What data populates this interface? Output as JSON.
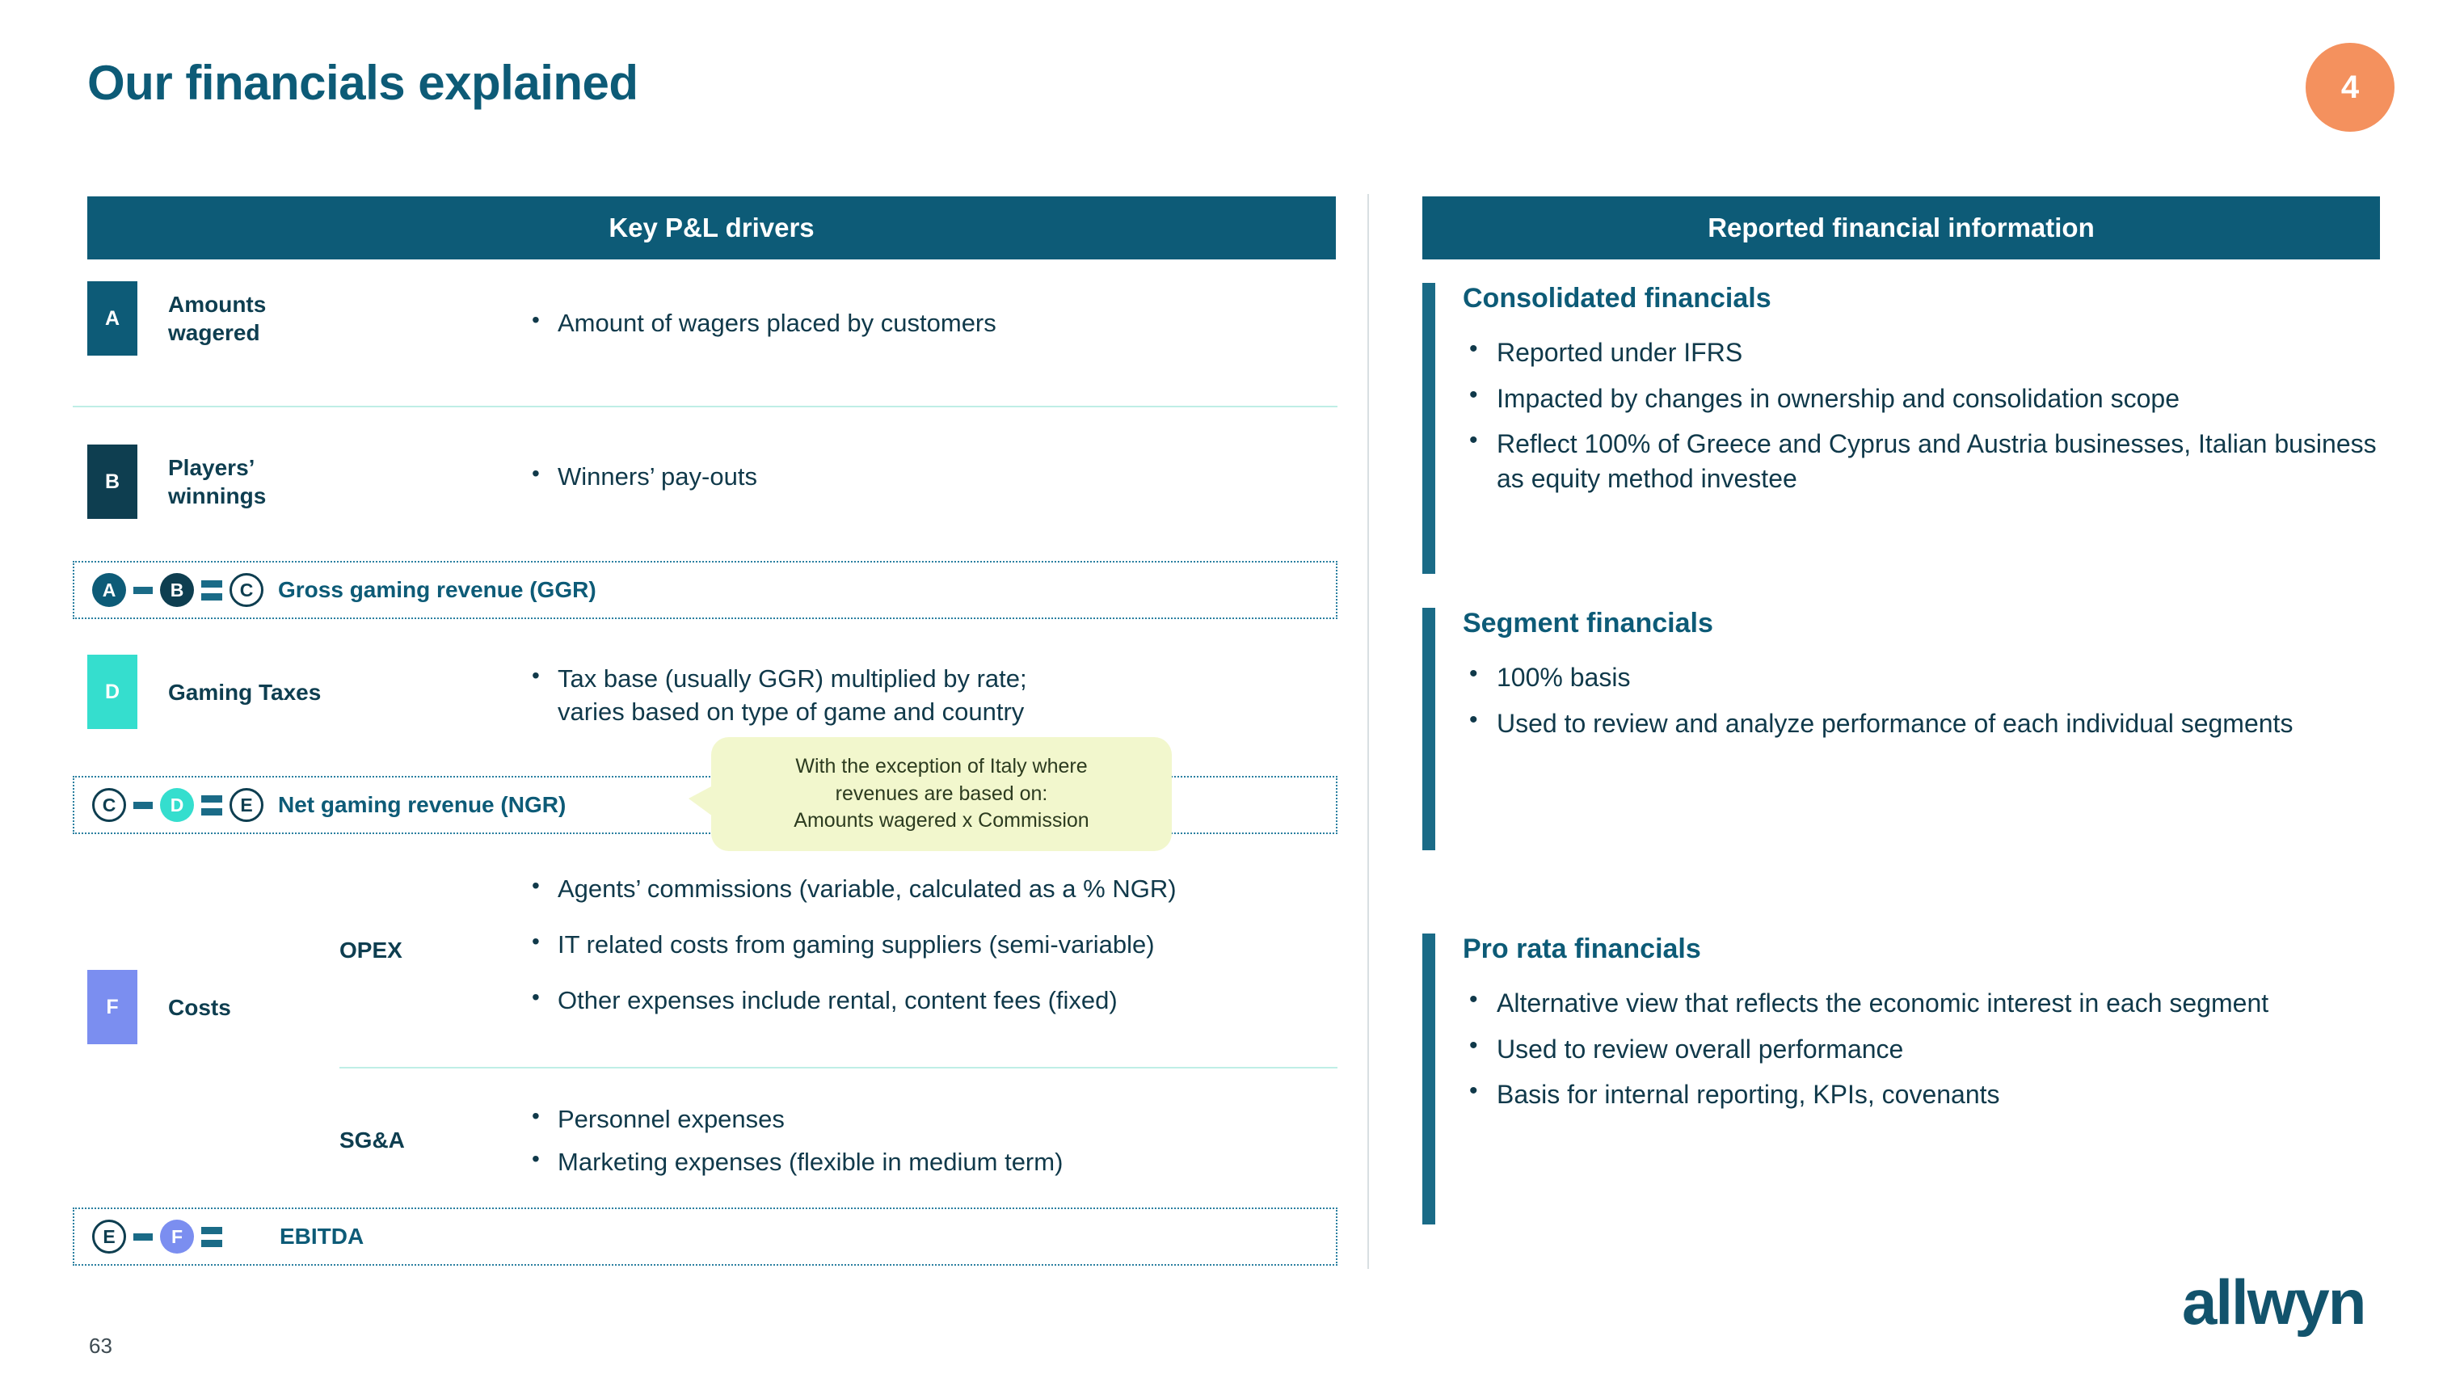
{
  "slide": {
    "title": "Our financials explained",
    "step_number": "4",
    "page_number": "63",
    "logo_text": "allwyn"
  },
  "colors": {
    "brand_teal": "#0d5b77",
    "dark_navy": "#0e3e50",
    "turquoise": "#35dece",
    "periwinkle": "#7b8ef0",
    "orange_badge": "#f4915e",
    "callout_bg": "#f2f7cd",
    "accent_bar": "#1a6b87"
  },
  "left_panel": {
    "header": "Key P&L drivers",
    "drivers": [
      {
        "tag": "A",
        "tag_color": "#0d5b77",
        "label": "Amounts\nwagered",
        "bullets": [
          "Amount of wagers placed by customers"
        ]
      },
      {
        "tag": "B",
        "tag_color": "#0e3e50",
        "label": "Players’\nwinnings",
        "bullets": [
          "Winners’ pay-outs"
        ]
      },
      {
        "tag": "D",
        "tag_color": "#35dece",
        "label": "Gaming Taxes",
        "bullets": [
          "Tax base (usually GGR) multiplied by rate;\nvaries based on type of game and country"
        ]
      },
      {
        "tag": "F",
        "tag_color": "#7b8ef0",
        "label": "Costs",
        "sub_groups": [
          {
            "name": "OPEX",
            "bullets": [
              "Agents’ commissions (variable, calculated as a % NGR)",
              "IT related costs from gaming suppliers (semi-variable)",
              "Other expenses include rental, content fees (fixed)"
            ]
          },
          {
            "name": "SG&A",
            "bullets": [
              "Personnel expenses",
              "Marketing expenses (flexible in medium term)"
            ]
          }
        ]
      }
    ],
    "formulas": [
      {
        "id": "ggr",
        "terms": [
          "A",
          "B",
          "C"
        ],
        "operators": [
          "minus",
          "equals"
        ],
        "label": "Gross gaming revenue (GGR)"
      },
      {
        "id": "ngr",
        "terms": [
          "C",
          "D",
          "E"
        ],
        "operators": [
          "minus",
          "equals"
        ],
        "label": "Net gaming revenue (NGR)"
      },
      {
        "id": "ebitda",
        "terms": [
          "E",
          "F"
        ],
        "operators": [
          "minus",
          "equals"
        ],
        "label": "EBITDA"
      }
    ],
    "callout": {
      "line1": "With the exception of Italy where",
      "line2": "revenues are based on:",
      "line3": "Amounts wagered x Commission"
    }
  },
  "right_panel": {
    "header": "Reported financial information",
    "sections": [
      {
        "title": "Consolidated financials",
        "bullets": [
          "Reported under IFRS",
          "Impacted by changes in ownership and consolidation scope",
          "Reflect 100% of Greece and Cyprus and Austria businesses, Italian business as equity method investee"
        ]
      },
      {
        "title": "Segment financials",
        "bullets": [
          "100% basis",
          "Used to review and analyze performance of each individual segments"
        ]
      },
      {
        "title": "Pro rata financials",
        "bullets": [
          "Alternative view that reflects the economic interest in each segment",
          "Used to review overall performance",
          "Basis for internal reporting, KPIs, covenants"
        ]
      }
    ]
  }
}
